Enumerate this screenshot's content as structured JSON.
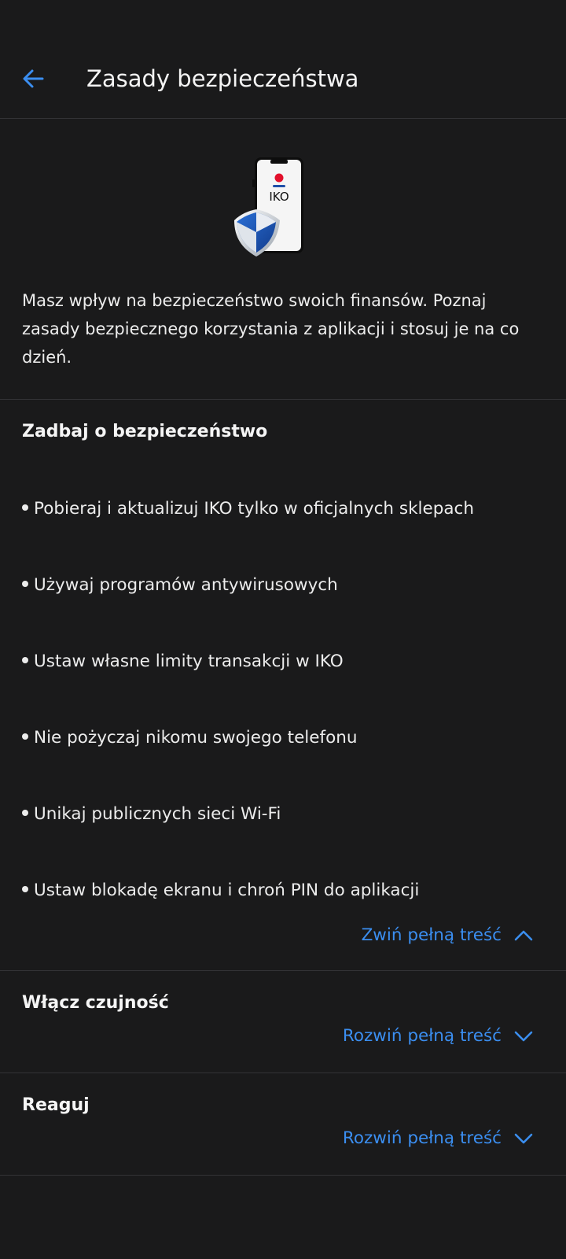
{
  "app_bar": {
    "title": "Zasady bezpieczeństwa",
    "back_icon": "arrow-left-icon"
  },
  "hero": {
    "illustration_icon": "phone-shield-icon",
    "phone_label": "IKO",
    "intro": "Masz wpływ na bezpieczeństwo swoich finansów. Poznaj zasady bezpiecznego korzystania z aplikacji i stosuj je na co dzień."
  },
  "sections": [
    {
      "title": "Zadbaj o bezpieczeństwo",
      "expanded": true,
      "items": [
        "Pobieraj i aktualizuj IKO tylko w oficjalnych sklepach",
        "Używaj programów antywirusowych",
        "Ustaw własne limity transakcji w IKO",
        "Nie pożyczaj nikomu swojego telefonu",
        "Unikaj publicznych sieci Wi-Fi",
        "Ustaw blokadę ekranu i chroń PIN do aplikacji"
      ],
      "toggle_label": "Zwiń pełną treść",
      "toggle_icon": "chevron-up-icon"
    },
    {
      "title": "Włącz czujność",
      "expanded": false,
      "toggle_label": "Rozwiń pełną treść",
      "toggle_icon": "chevron-down-icon"
    },
    {
      "title": "Reaguj",
      "expanded": false,
      "toggle_label": "Rozwiń pełną treść",
      "toggle_icon": "chevron-down-icon"
    }
  ],
  "colors": {
    "background": "#1a1a1b",
    "accent": "#3b8ef0",
    "divider": "#333336",
    "brand_red": "#e2102b",
    "shield_blue": "#1e5bbf"
  }
}
